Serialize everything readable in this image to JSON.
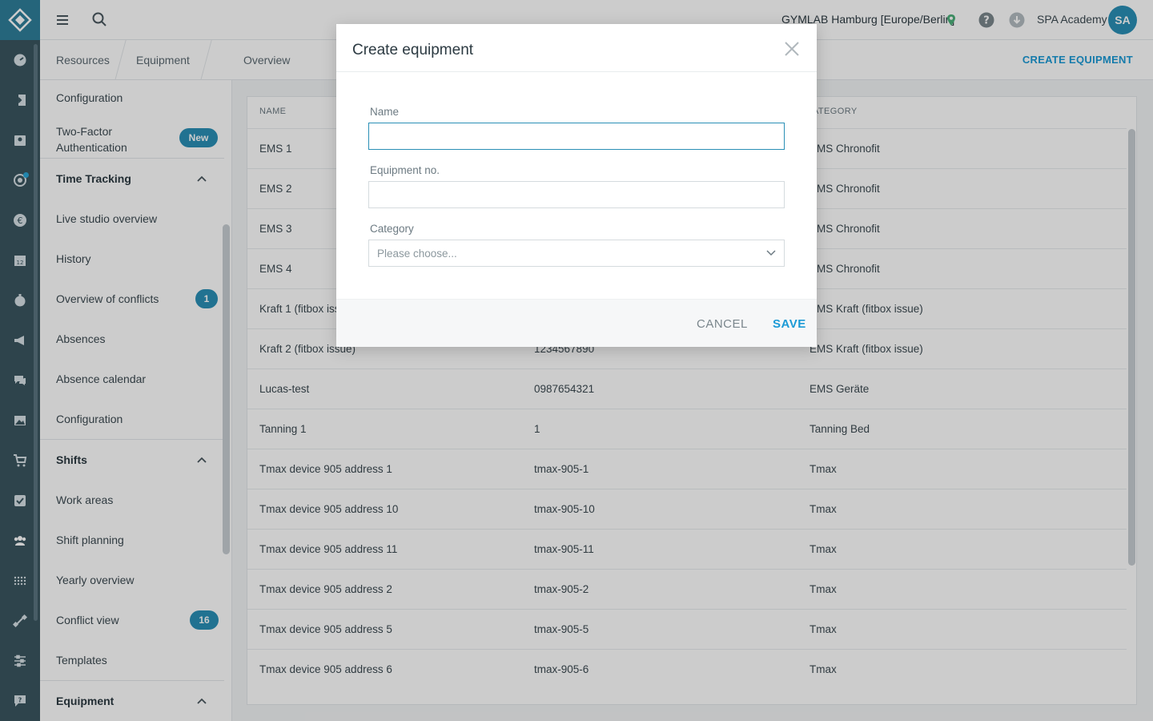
{
  "topbar": {
    "location": "GYMLAB Hamburg [Europe/Berlin]",
    "user_name": "SPA Academy",
    "avatar_initials": "SA"
  },
  "breadcrumb": {
    "items": [
      "Resources",
      "Equipment",
      "Overview"
    ],
    "action": "CREATE EQUIPMENT"
  },
  "sidebar": {
    "top_items": [
      "Configuration",
      "Two-Factor Authentication"
    ],
    "two_factor_badge": "New",
    "time_tracking": {
      "heading": "Time Tracking",
      "items": [
        "Live studio overview",
        "History",
        "Overview of conflicts",
        "Absences",
        "Absence calendar",
        "Configuration"
      ],
      "conflicts_badge": "1"
    },
    "shifts": {
      "heading": "Shifts",
      "items": [
        "Work areas",
        "Shift planning",
        "Yearly overview",
        "Conflict view",
        "Templates"
      ],
      "conflict_view_badge": "16"
    },
    "equipment": {
      "heading": "Equipment"
    }
  },
  "table": {
    "headers": [
      "NAME",
      "ATEGORY"
    ],
    "rows": [
      {
        "name": "EMS 1",
        "no": "",
        "category": "EMS Chronofit"
      },
      {
        "name": "EMS 2",
        "no": "",
        "category": "EMS Chronofit"
      },
      {
        "name": "EMS 3",
        "no": "",
        "category": "EMS Chronofit"
      },
      {
        "name": "EMS 4",
        "no": "",
        "category": "EMS Chronofit"
      },
      {
        "name": "Kraft 1 (fitbox iss",
        "no": "",
        "category": "EMS Kraft (fitbox issue)"
      },
      {
        "name": "Kraft 2 (fitbox issue)",
        "no": "1234567890",
        "category": "EMS Kraft (fitbox issue)"
      },
      {
        "name": "Lucas-test",
        "no": "0987654321",
        "category": "EMS Geräte"
      },
      {
        "name": "Tanning 1",
        "no": "1",
        "category": "Tanning Bed"
      },
      {
        "name": "Tmax device 905 address 1",
        "no": "tmax-905-1",
        "category": "Tmax"
      },
      {
        "name": "Tmax device 905 address 10",
        "no": "tmax-905-10",
        "category": "Tmax"
      },
      {
        "name": "Tmax device 905 address 11",
        "no": "tmax-905-11",
        "category": "Tmax"
      },
      {
        "name": "Tmax device 905 address 2",
        "no": "tmax-905-2",
        "category": "Tmax"
      },
      {
        "name": "Tmax device 905 address 5",
        "no": "tmax-905-5",
        "category": "Tmax"
      },
      {
        "name": "Tmax device 905 address 6",
        "no": "tmax-905-6",
        "category": "Tmax"
      }
    ]
  },
  "modal": {
    "title": "Create equipment",
    "name_label": "Name",
    "name_value": "",
    "equipment_no_label": "Equipment no.",
    "equipment_no_value": "",
    "category_label": "Category",
    "category_placeholder": "Please choose...",
    "cancel": "CANCEL",
    "save": "SAVE"
  },
  "colors": {
    "accent": "#1b9ad6",
    "rail": "#3a5560",
    "badge": "#2a8fb6"
  }
}
